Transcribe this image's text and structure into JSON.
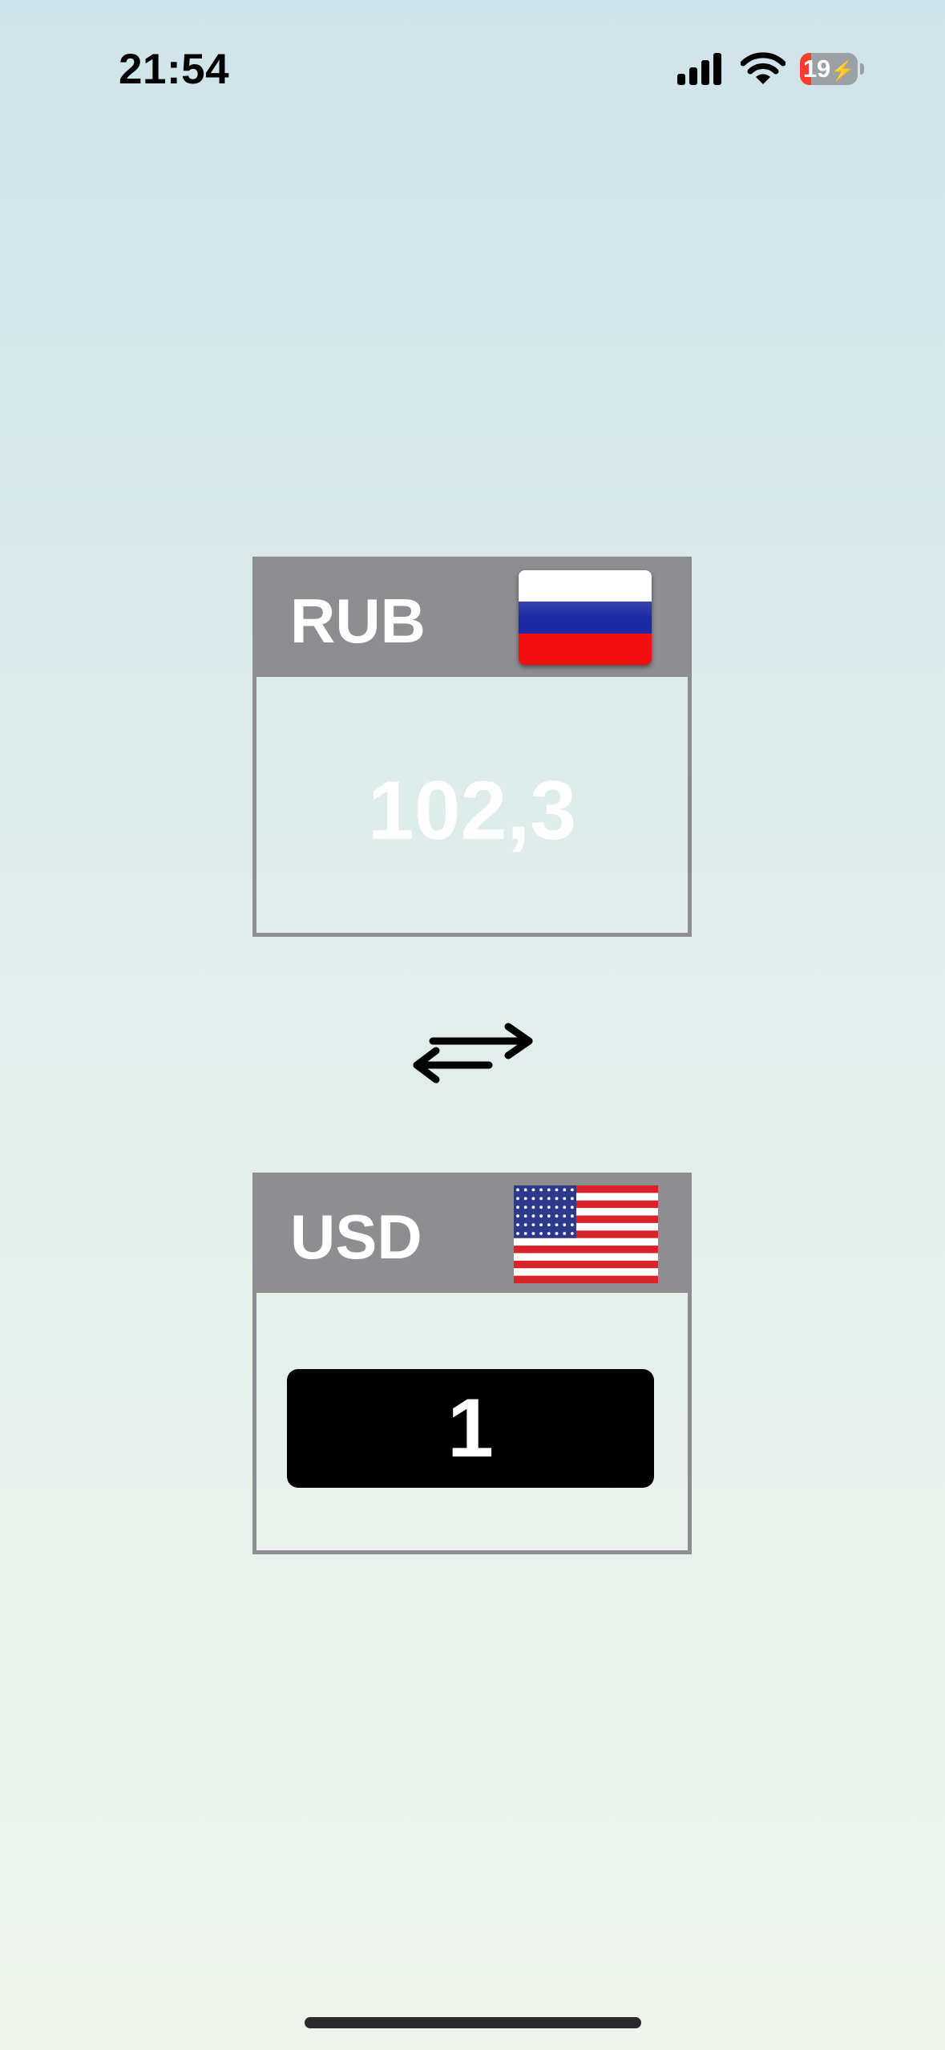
{
  "status_bar": {
    "time": "21:54",
    "battery_level": "19",
    "battery_charging": true,
    "signal_icon": "cellular-signal-icon",
    "wifi_icon": "wifi-icon"
  },
  "source_currency": {
    "code": "RUB",
    "flag": "flag-russia-icon",
    "value": "102,3"
  },
  "swap": {
    "icon": "swap-arrows-icon"
  },
  "target_currency": {
    "code": "USD",
    "flag": "flag-usa-icon",
    "value": "1"
  },
  "colors": {
    "card": "#8e8d92",
    "input_bg": "#000000",
    "value_text": "#ffffff",
    "battery_low": "#ff3b30"
  }
}
